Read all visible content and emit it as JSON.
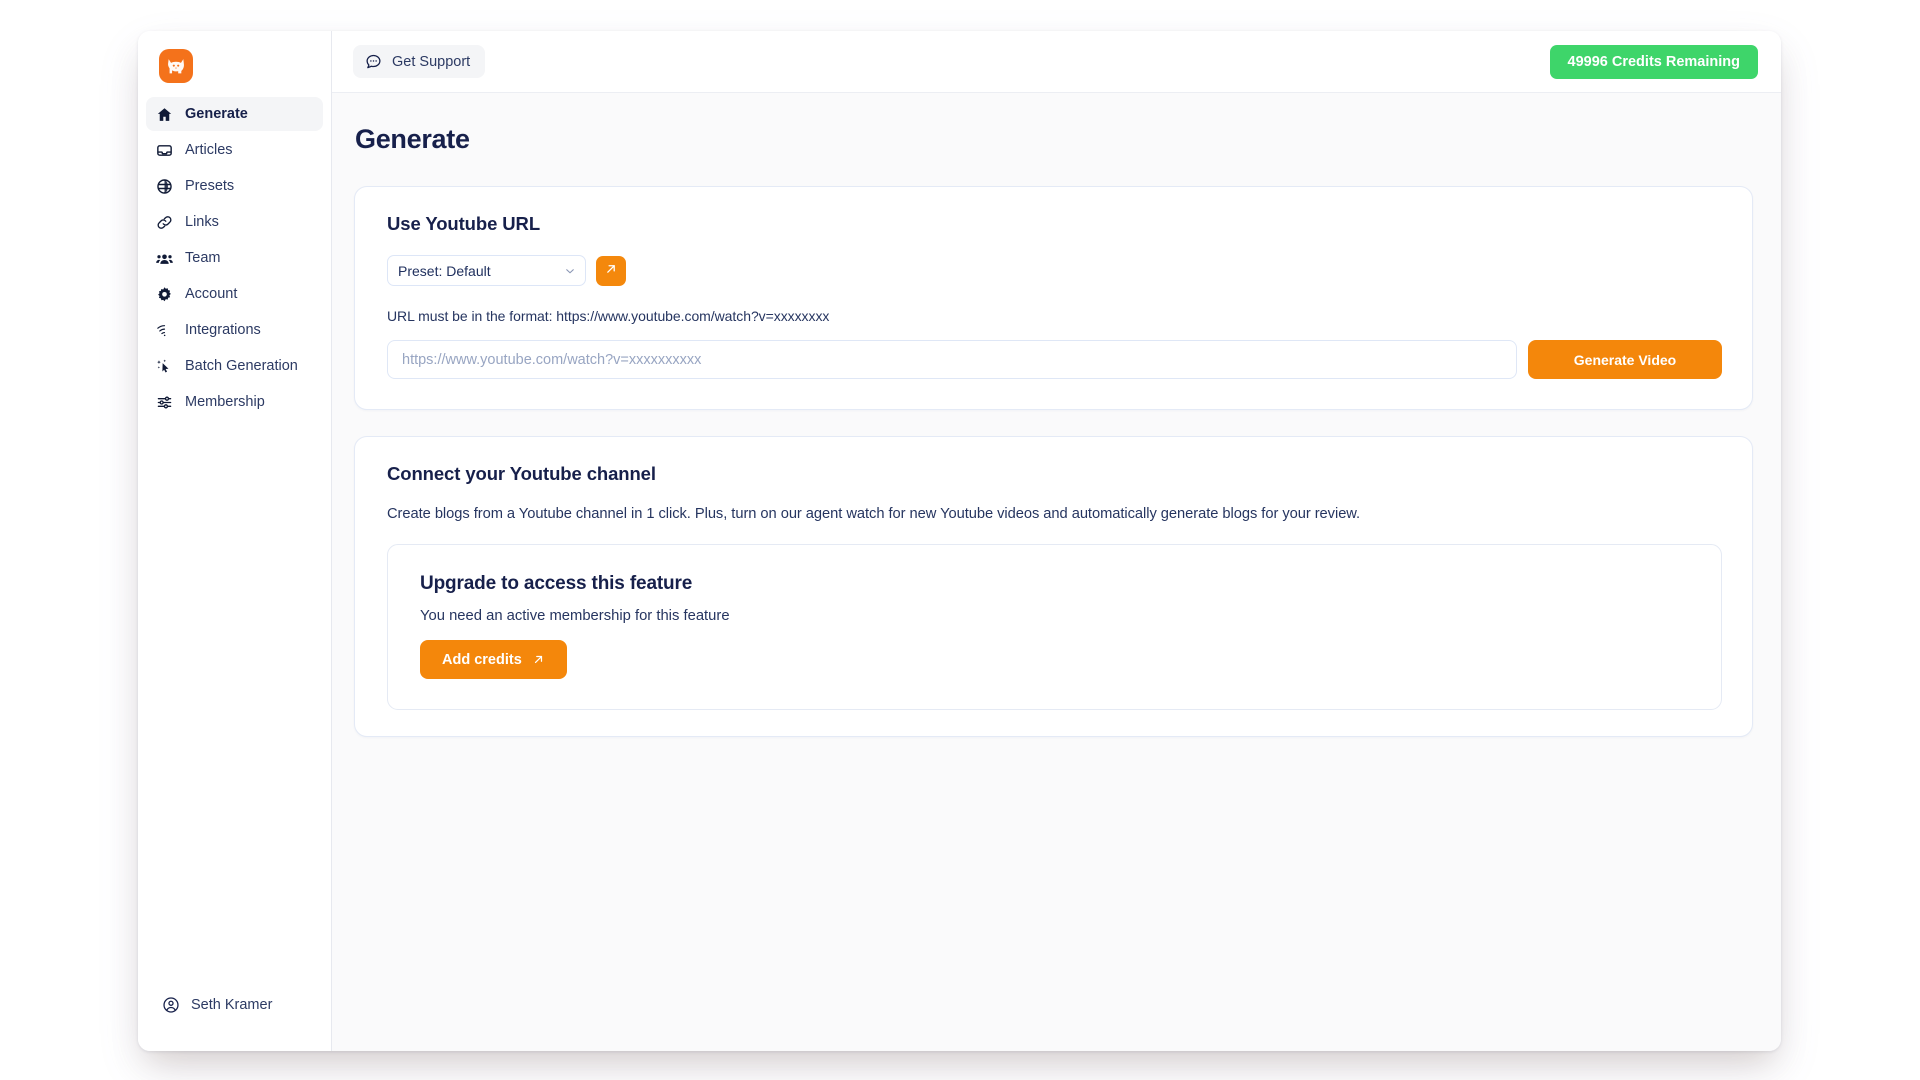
{
  "app": {
    "logo_icon": "fox-logo-icon",
    "accent_orange": "#f4870b",
    "green": "#3ed56a",
    "navy": "#17204b"
  },
  "sidebar": {
    "items": [
      {
        "label": "Generate",
        "icon": "home-icon",
        "active": true
      },
      {
        "label": "Articles",
        "icon": "inbox-icon",
        "active": false
      },
      {
        "label": "Presets",
        "icon": "globe-icon",
        "active": false
      },
      {
        "label": "Links",
        "icon": "link-icon",
        "active": false
      },
      {
        "label": "Team",
        "icon": "users-icon",
        "active": false
      },
      {
        "label": "Account",
        "icon": "gear-icon",
        "active": false
      },
      {
        "label": "Integrations",
        "icon": "wifi-icon",
        "active": false
      },
      {
        "label": "Batch Generation",
        "icon": "sparkle-cursor-icon",
        "active": false
      },
      {
        "label": "Membership",
        "icon": "sliders-icon",
        "active": false
      }
    ],
    "user": {
      "name": "Seth Kramer",
      "icon": "user-circle-icon"
    }
  },
  "topbar": {
    "support_label": "Get Support",
    "support_icon": "chat-bubble-dots-icon",
    "credits_label": "49996 Credits Remaining"
  },
  "page": {
    "title": "Generate"
  },
  "youtube_card": {
    "title": "Use Youtube URL",
    "preset_value": "Preset: Default",
    "preset_chevron_icon": "chevron-down-icon",
    "preset_action_icon": "arrow-up-right-icon",
    "hint": "URL must be in the format: https://www.youtube.com/watch?v=xxxxxxxx",
    "url_value": "",
    "url_placeholder": "https://www.youtube.com/watch?v=xxxxxxxxxx",
    "generate_label": "Generate Video"
  },
  "channel_card": {
    "title": "Connect your Youtube channel",
    "description": "Create blogs from a Youtube channel in 1 click. Plus, turn on our agent watch for new Youtube videos and automatically generate blogs for your review.",
    "upgrade": {
      "title": "Upgrade to access this feature",
      "subtitle": "You need an active membership for this feature",
      "button_label": "Add credits",
      "button_icon": "arrow-up-right-icon"
    }
  }
}
